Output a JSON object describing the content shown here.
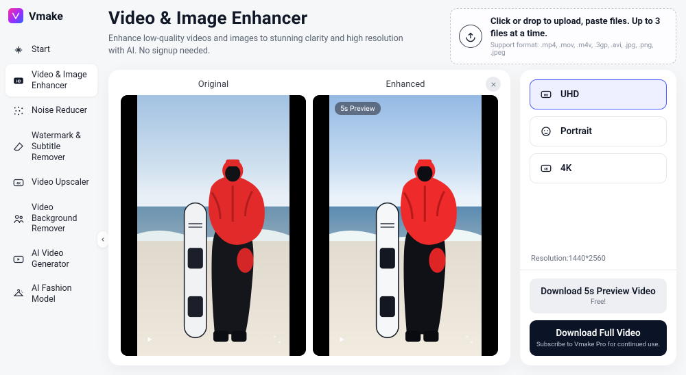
{
  "brand": {
    "name": "Vmake"
  },
  "sidebar": {
    "items": [
      {
        "label": "Start"
      },
      {
        "label": "Video & Image Enhancer"
      },
      {
        "label": "Noise Reducer"
      },
      {
        "label": "Watermark & Subtitle Remover"
      },
      {
        "label": "Video Upscaler"
      },
      {
        "label": "Video Background Remover"
      },
      {
        "label": "AI Video Generator"
      },
      {
        "label": "AI Fashion Model"
      }
    ]
  },
  "header": {
    "title": "Video & Image Enhancer",
    "subtitle": "Enhance low-quality videos and images to stunning clarity and high resolution with AI. No signup needed."
  },
  "upload": {
    "title": "Click or drop to upload, paste files. Up to 3 files at a time.",
    "formats": "Support format: .mp4, .mov, .m4v, .3gp, .avi, .jpg, .png, .jpeg"
  },
  "compare": {
    "original_label": "Original",
    "enhanced_label": "Enhanced",
    "preview_badge": "5s Preview"
  },
  "modes": [
    {
      "key": "uhd",
      "label": "UHD"
    },
    {
      "key": "portrait",
      "label": "Portrait"
    },
    {
      "key": "4k",
      "label": "4K"
    }
  ],
  "panel": {
    "resolution_label": "Resolution:",
    "resolution_value": "1440*2560",
    "download_preview": {
      "title": "Download 5s Preview Video",
      "sub": "Free!"
    },
    "download_full": {
      "title": "Download Full Video",
      "sub": "Subscribe to Vmake Pro for continued use."
    }
  }
}
